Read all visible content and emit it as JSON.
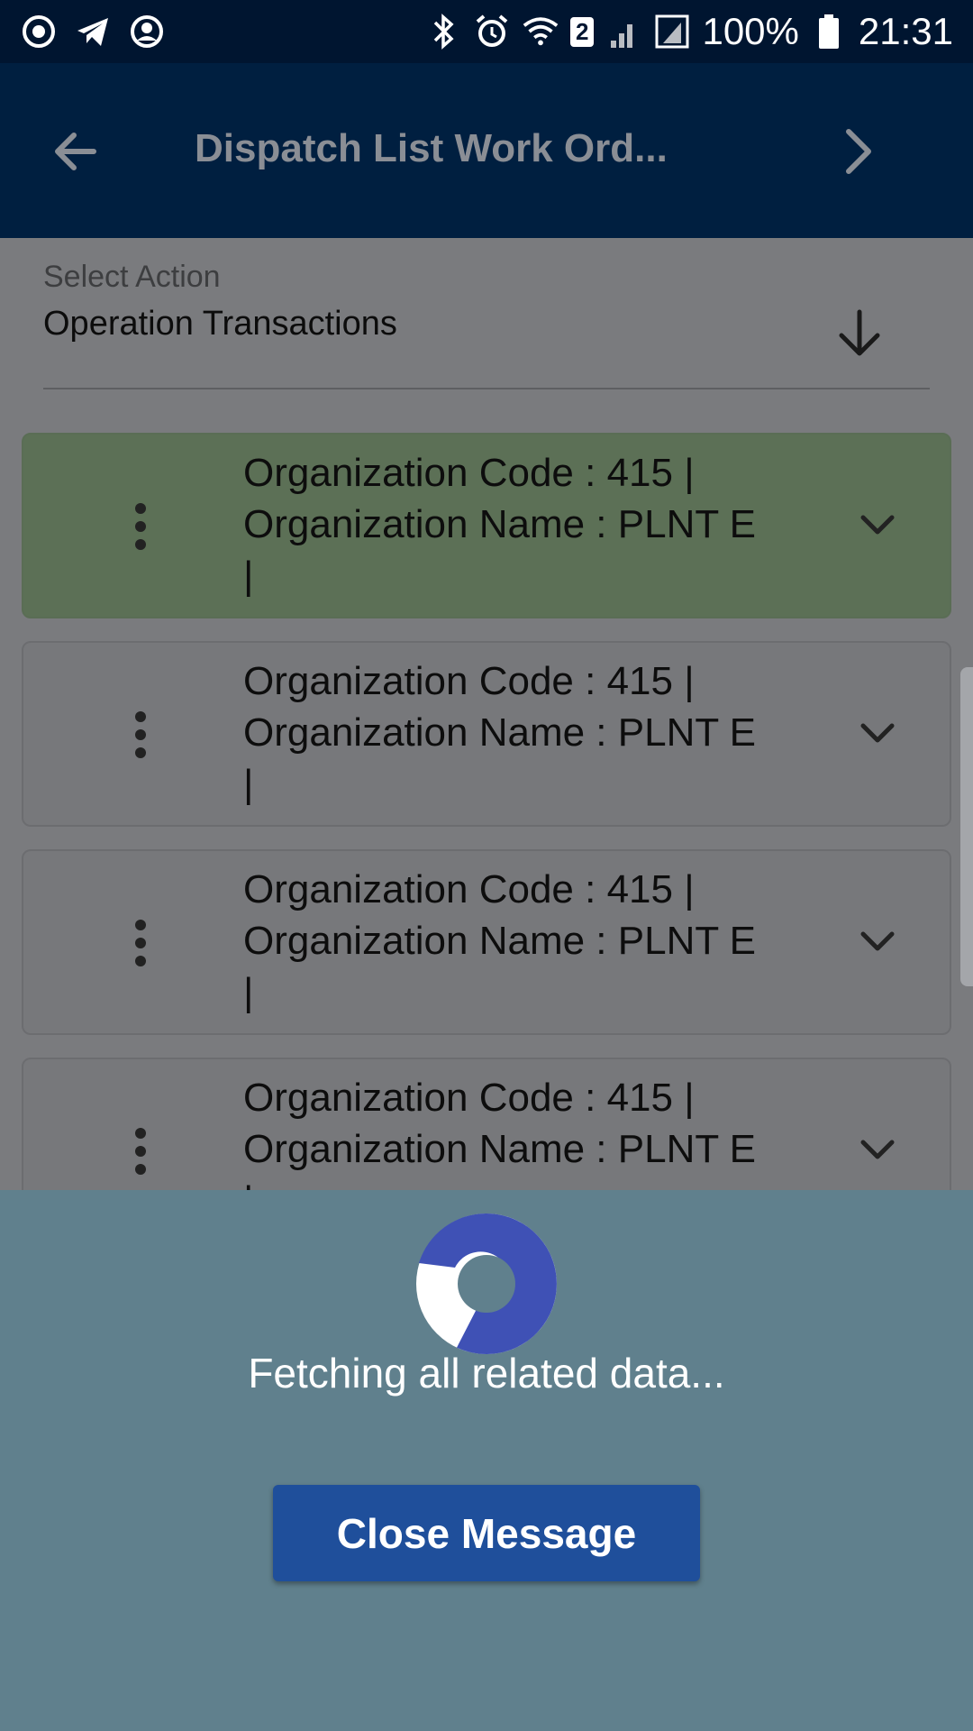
{
  "status_bar": {
    "icons_left": [
      "play-circle-icon",
      "telegram-icon",
      "account-circle-icon"
    ],
    "icons_right": [
      "bluetooth-icon",
      "alarm-icon",
      "wifi-icon",
      "sim-icon",
      "signal-icon"
    ],
    "sim_badge": "2",
    "battery": "100%",
    "time": "21:31"
  },
  "app_bar": {
    "title": "Dispatch List Work Ord...",
    "back_icon": "arrow-back-icon",
    "forward_icon": "chevron-right-icon"
  },
  "select_action": {
    "label": "Select Action",
    "value": "Operation Transactions"
  },
  "cards": [
    {
      "text": "Organization Code : 415 |\nOrganization Name : PLNT E\n|",
      "selected": true
    },
    {
      "text": "Organization Code : 415 |\nOrganization Name : PLNT E\n|",
      "selected": false
    },
    {
      "text": "Organization Code : 415 |\nOrganization Name : PLNT E\n|",
      "selected": false
    },
    {
      "text": "Organization Code : 415 |\nOrganization Name : PLNT E\n|",
      "selected": false
    }
  ],
  "overlay": {
    "message": "Fetching all related data...",
    "close_label": "Close Message"
  },
  "colors": {
    "status_bar": "#001530",
    "app_bar": "#001f40",
    "selected_card": "#5c7056",
    "overlay": "#60808d",
    "button": "#1f4f9b",
    "spinner": "#3f51b5"
  }
}
